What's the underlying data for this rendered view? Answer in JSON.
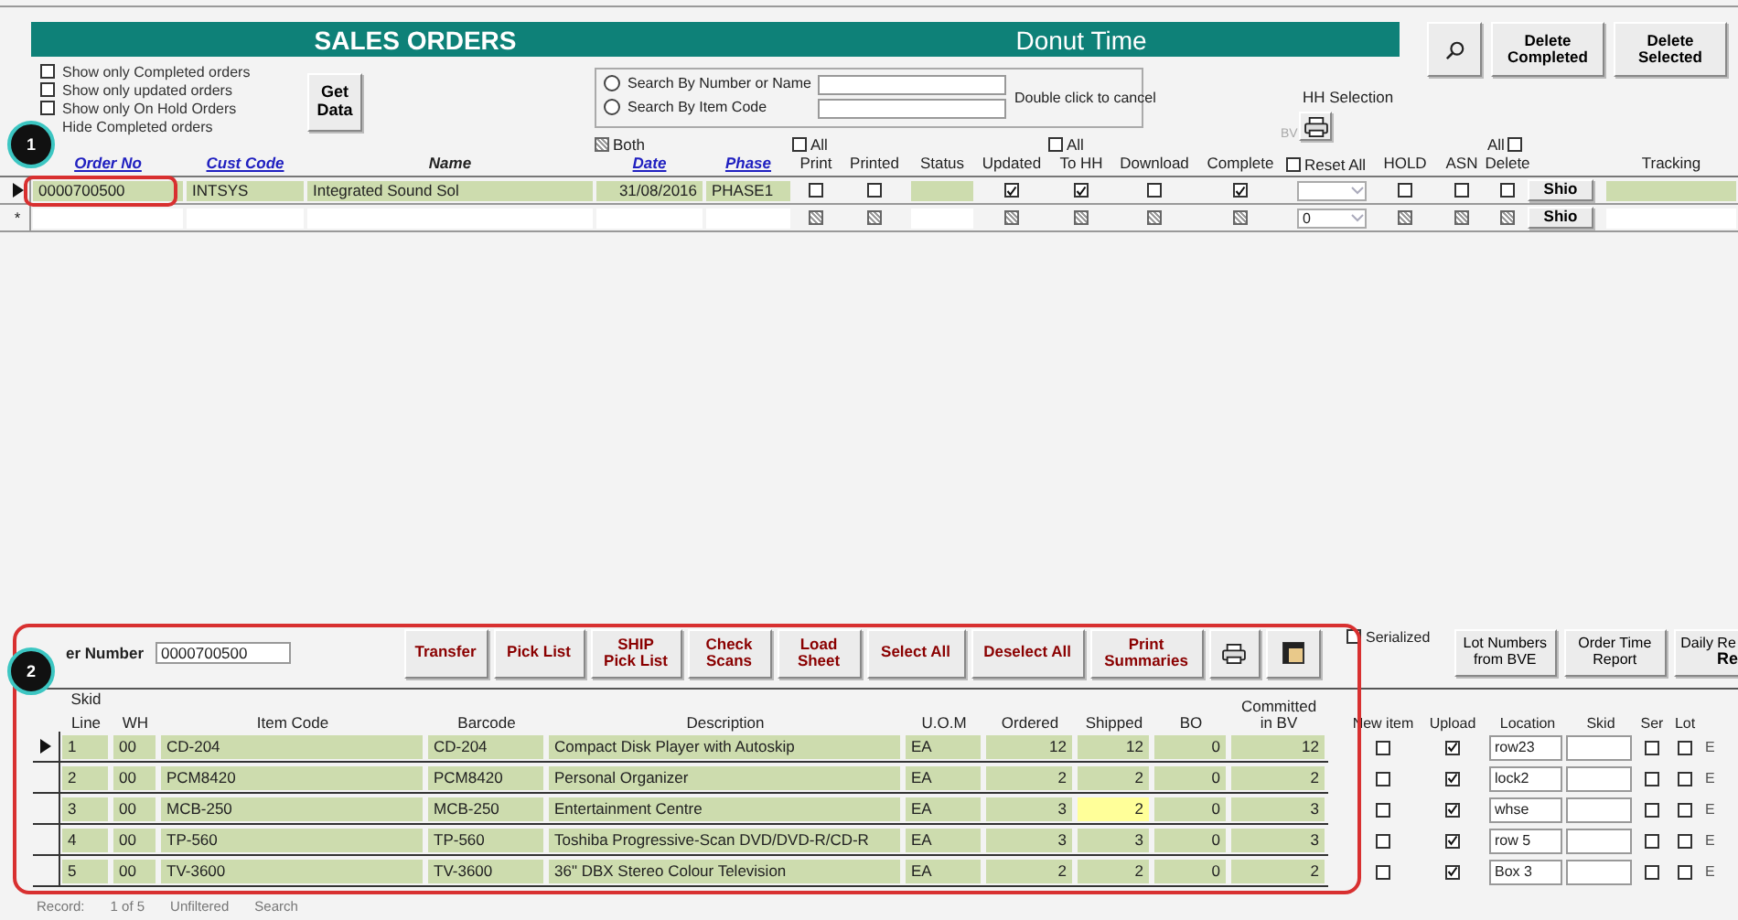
{
  "header": {
    "title": "SALES ORDERS",
    "company": "Donut Time",
    "buttons": [
      {
        "label": "Delete Completed"
      },
      {
        "label": "Delete Selected"
      }
    ]
  },
  "filters": [
    {
      "label": "Show only Completed orders",
      "checked": false
    },
    {
      "label": "Show only updated orders",
      "checked": false
    },
    {
      "label": "Show only On Hold Orders",
      "checked": false
    },
    {
      "label": "Hide Completed orders"
    }
  ],
  "get_data_button": "Get Data",
  "search": {
    "options": [
      {
        "label": "Search By Number or Name",
        "selected": false
      },
      {
        "label": "Search By Item Code",
        "selected": false
      }
    ],
    "hint": "Double click to cancel"
  },
  "hh_selection": {
    "label": "HH Selection",
    "bv_label": "BV"
  },
  "orders": {
    "above": [
      {
        "label": "Both",
        "indeterminate": true
      },
      {
        "label": "All",
        "checked": false
      },
      {
        "label": "All",
        "checked": false
      },
      {
        "label": "All",
        "checked": false
      }
    ],
    "reset_all": {
      "label": "Reset All",
      "checked": false
    },
    "columns": [
      {
        "label": "Order No",
        "kind": "link"
      },
      {
        "label": "Cust Code",
        "kind": "link"
      },
      {
        "label": "Name",
        "kind": "heading"
      },
      {
        "label": "Date",
        "kind": "link"
      },
      {
        "label": "Phase",
        "kind": "link"
      },
      {
        "label": "Print",
        "kind": "plain"
      },
      {
        "label": "Printed",
        "kind": "plain"
      },
      {
        "label": "Status",
        "kind": "plain"
      },
      {
        "label": "Updated",
        "kind": "plain"
      },
      {
        "label": "To HH",
        "kind": "plain"
      },
      {
        "label": "Download",
        "kind": "plain"
      },
      {
        "label": "Complete",
        "kind": "plain"
      },
      {
        "label": "HOLD",
        "kind": "plain"
      },
      {
        "label": "ASN",
        "kind": "plain"
      },
      {
        "label": "Delete",
        "kind": "plain"
      },
      {
        "label": "Tracking",
        "kind": "plain"
      }
    ],
    "rows": [
      {
        "kind": "record",
        "current": true,
        "order_no": "0000700500",
        "cust_code": "INTSYS",
        "name": "Integrated Sound Sol",
        "date": "31/08/2016",
        "phase": "PHASE1",
        "ship_button": "Shio",
        "checks": [
          {
            "checked": false
          },
          {
            "checked": false
          },
          {
            "checked": true
          },
          {
            "checked": true
          },
          {
            "checked": false
          },
          {
            "checked": true
          },
          {
            "checked": false
          },
          {
            "checked": false
          },
          {
            "checked": false
          }
        ]
      },
      {
        "kind": "new",
        "current": false,
        "marker": "*",
        "combo_value": "0",
        "ship_button": "Shio",
        "checks": [
          {
            "indeterminate": true
          },
          {
            "indeterminate": true
          },
          {
            "indeterminate": true
          },
          {
            "indeterminate": true
          },
          {
            "indeterminate": true
          },
          {
            "indeterminate": true
          },
          {
            "indeterminate": true
          },
          {
            "indeterminate": true
          },
          {
            "indeterminate": true
          }
        ]
      }
    ]
  },
  "order_number": {
    "label": "er Number",
    "value": "0000700500"
  },
  "actions": [
    {
      "kind": "text",
      "label": "Transfer"
    },
    {
      "kind": "text",
      "label": "Pick List"
    },
    {
      "kind": "text",
      "label": "SHIP\nPick List"
    },
    {
      "kind": "text",
      "label": "Check\nScans"
    },
    {
      "kind": "text",
      "label": "Load\nSheet"
    },
    {
      "kind": "text",
      "label": "Select All"
    },
    {
      "kind": "text",
      "label": "Deselect All"
    },
    {
      "kind": "text",
      "label": "Print\nSummaries"
    },
    {
      "kind": "printer"
    },
    {
      "kind": "grid"
    }
  ],
  "serialized": {
    "label": "Serialized",
    "checked": false
  },
  "side_buttons": [
    {
      "label": "Lot Numbers\nfrom BVE"
    },
    {
      "label": "Order Time\nReport"
    }
  ],
  "daily_button": {
    "label": "Daily Re",
    "sub": "Re"
  },
  "lines": {
    "skid_label": "Skid",
    "columns": [
      "Line",
      "WH",
      "Item Code",
      "Barcode",
      "Description",
      "U.O.M",
      "Ordered",
      "Shipped",
      "BO",
      "Committed\nin BV",
      "New item",
      "Upload",
      "Location",
      "Skid",
      "Ser",
      "Lot"
    ],
    "rows": [
      {
        "current": true,
        "line": "1",
        "wh": "00",
        "item_code": "CD-204",
        "barcode": "CD-204",
        "description": "Compact Disk Player with Autoskip",
        "uom": "EA",
        "ordered": "12",
        "shipped": "12",
        "highlighted": false,
        "bo": "0",
        "committed": "12",
        "new_item": false,
        "upload": true,
        "location": "row23",
        "ser": false,
        "lot": false,
        "column_17": "E"
      },
      {
        "current": false,
        "line": "2",
        "wh": "00",
        "item_code": "PCM8420",
        "barcode": "PCM8420",
        "description": "Personal Organizer",
        "uom": "EA",
        "ordered": "2",
        "shipped": "2",
        "highlighted": false,
        "bo": "0",
        "committed": "2",
        "new_item": false,
        "upload": true,
        "location": "lock2",
        "ser": false,
        "lot": false,
        "column_17": "E"
      },
      {
        "current": false,
        "line": "3",
        "wh": "00",
        "item_code": "MCB-250",
        "barcode": "MCB-250",
        "description": "Entertainment Centre",
        "uom": "EA",
        "ordered": "3",
        "shipped": "2",
        "highlighted": true,
        "bo": "0",
        "committed": "3",
        "new_item": false,
        "upload": true,
        "location": "whse",
        "ser": false,
        "lot": false,
        "column_17": "E"
      },
      {
        "current": false,
        "line": "4",
        "wh": "00",
        "item_code": "TP-560",
        "barcode": "TP-560",
        "description": "Toshiba Progressive-Scan DVD/DVD-R/CD-R",
        "uom": "EA",
        "ordered": "3",
        "shipped": "3",
        "highlighted": false,
        "bo": "0",
        "committed": "3",
        "new_item": false,
        "upload": true,
        "location": "row 5",
        "ser": false,
        "lot": false,
        "column_17": "E"
      },
      {
        "current": false,
        "line": "5",
        "wh": "00",
        "item_code": "TV-3600",
        "barcode": "TV-3600",
        "description": "36\" DBX Stereo Colour Television",
        "uom": "EA",
        "ordered": "2",
        "shipped": "2",
        "highlighted": false,
        "bo": "0",
        "committed": "2",
        "new_item": false,
        "upload": true,
        "location": "Box 3",
        "ser": false,
        "lot": false,
        "column_17": "E"
      }
    ]
  },
  "record_nav": {
    "label": "Record:",
    "position": "1 of 5",
    "filter": "Unfiltered",
    "search": "Search"
  },
  "callouts": [
    {
      "label": "1"
    },
    {
      "label": "2"
    }
  ]
}
